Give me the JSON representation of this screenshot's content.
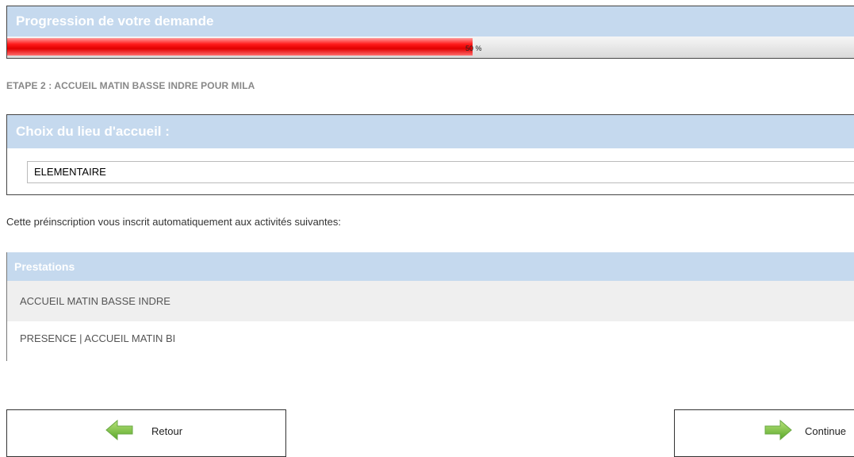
{
  "progress": {
    "title": "Progression de votre demande",
    "percent_label": "50 %",
    "value": 0.5
  },
  "step": {
    "title": "ETAPE 2 : ACCUEIL MATIN BASSE INDRE POUR MILA"
  },
  "location": {
    "title": "Choix du lieu d'accueil :",
    "selected": "ELEMENTAIRE"
  },
  "info": {
    "text": "Cette préinscription vous inscrit automatiquement aux activités suivantes:"
  },
  "prestations": {
    "header": "Prestations",
    "rows": [
      "ACCUEIL MATIN BASSE INDRE",
      "PRESENCE          | ACCUEIL MATIN BI"
    ]
  },
  "buttons": {
    "back_label": "Retour",
    "continue_label": "Continue"
  },
  "icons": {
    "back": "arrow-left-icon",
    "continue": "arrow-right-icon"
  },
  "colors": {
    "header_bg": "#c5d9ee",
    "progress_fill": "#ff1a1a",
    "arrow_green": "#7cc243"
  }
}
